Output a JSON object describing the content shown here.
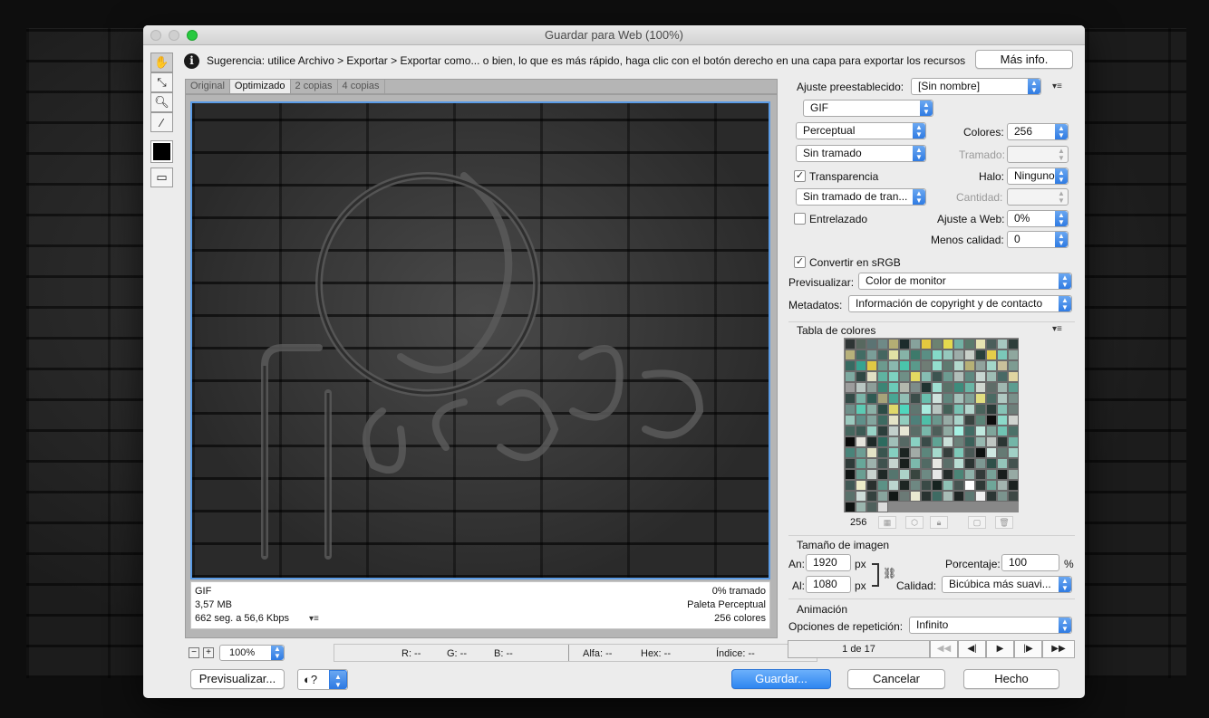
{
  "window": {
    "title": "Guardar para Web (100%)"
  },
  "hint": {
    "icon": "info-icon",
    "text": "Sugerencia: utilice Archivo > Exportar > Exportar como... o bien, lo que es más rápido, haga clic con el botón derecho en una capa para exportar los recursos",
    "more_button": "Más info."
  },
  "tools": [
    "hand-tool-icon",
    "slice-select-tool-icon",
    "zoom-tool-icon",
    "eyedropper-tool-icon",
    "eyedropper-color-icon",
    "toggle-slices-icon"
  ],
  "tabs": [
    "Original",
    "Optimizado",
    "2 copias",
    "4 copias"
  ],
  "preview_info": {
    "format": "GIF",
    "size": "3,57 MB",
    "time": "662 seg. a 56,6 Kbps",
    "dither": "0% tramado",
    "palette": "Paleta Perceptual",
    "colors": "256 colores"
  },
  "statusbar": {
    "zoom": "100%",
    "r_label": "R: --",
    "g_label": "G: --",
    "b_label": "B: --",
    "alpha_label": "Alfa: --",
    "hex_label": "Hex: --",
    "index_label": "Índice: --"
  },
  "settings": {
    "preset_label": "Ajuste preestablecido:",
    "preset_value": "[Sin nombre]",
    "format": "GIF",
    "reduction": "Perceptual",
    "colors_label": "Colores:",
    "colors_value": "256",
    "dither_algo": "Sin tramado",
    "dither_label": "Tramado:",
    "transparency_label": "Transparencia",
    "transparency_checked": true,
    "matte_label": "Halo:",
    "matte_value": "Ninguno",
    "transparency_dither": "Sin tramado de tran...",
    "amount_label": "Cantidad:",
    "interlaced_label": "Entrelazado",
    "interlaced_checked": false,
    "web_snap_label": "Ajuste a Web:",
    "web_snap_value": "0%",
    "lossy_label": "Menos calidad:",
    "lossy_value": "0",
    "srgb_label": "Convertir en sRGB",
    "srgb_checked": true,
    "preview_label": "Previsualizar:",
    "preview_value": "Color de monitor",
    "metadata_label": "Metadatos:",
    "metadata_value": "Información de copyright y de contacto"
  },
  "color_table": {
    "title": "Tabla de colores",
    "count": "256",
    "colors": [
      "#2e3535",
      "#57685f",
      "#5b7373",
      "#6f8a87",
      "#b4ae74",
      "#1c2c2c",
      "#87a29c",
      "#e5c93f",
      "#6c8271",
      "#e4d94e",
      "#72b2a5",
      "#5a7a6c",
      "#e6e3b2",
      "#4a5e5b",
      "#a6c7c0",
      "#2d3d3a",
      "#b7b17b",
      "#426c64",
      "#7a9e98",
      "#456660",
      "#e2e1a5",
      "#86b3a7",
      "#3d7a6b",
      "#5a8f84",
      "#84d9c8",
      "#96c8bd",
      "#9dadaa",
      "#c8cfc9",
      "#29403b",
      "#e4cd4a",
      "#7bc8b9",
      "#8fa79e",
      "#376a61",
      "#36a391",
      "#e1c844",
      "#6c9a8e",
      "#8ab8af",
      "#4ac4ab",
      "#5a9a8b",
      "#6f7d75",
      "#93dfce",
      "#5e7a70",
      "#b3d9cd",
      "#b6b076",
      "#91a39d",
      "#a3d6c9",
      "#c9c09b",
      "#7d9c92",
      "#7eaaa1",
      "#2f4743",
      "#e1e0c4",
      "#5fb3a1",
      "#7dd1c0",
      "#6f8f86",
      "#e2da61",
      "#86bdb2",
      "#3c5450",
      "#6d9b91",
      "#b1bfba",
      "#5e8980",
      "#c7d6d1",
      "#9ebdb4",
      "#486965",
      "#e0d5a1",
      "#9c9c9c",
      "#b9c6c2",
      "#8e9e99",
      "#3c8575",
      "#6bcbb8",
      "#b3b8ad",
      "#7d8c89",
      "#1f3331",
      "#9fe0d2",
      "#597268",
      "#3d8c7c",
      "#6ab5a5",
      "#cfd6cf",
      "#5f6c68",
      "#a0b7b0",
      "#5c9d90",
      "#334a46",
      "#7ab4a8",
      "#2f5a53",
      "#a7a37a",
      "#49a694",
      "#92bfb4",
      "#3b4d49",
      "#69bfae",
      "#cfe2dc",
      "#60867d",
      "#a5c1ba",
      "#7fa097",
      "#e2de80",
      "#4b6a63",
      "#b0c9c2",
      "#79908a",
      "#6e8f89",
      "#5ccab3",
      "#8bb1a7",
      "#2c4b45",
      "#e0d86a",
      "#4fd6bd",
      "#5f7670",
      "#a8ebde",
      "#b8c5c0",
      "#436057",
      "#78c2b3",
      "#b3d5cd",
      "#49625b",
      "#2a3a37",
      "#86c3b6",
      "#6d7f7a",
      "#9bc9be",
      "#5f908a",
      "#83a59e",
      "#3d6a61",
      "#e4e3c7",
      "#91ccbf",
      "#4e807a",
      "#4ebfa8",
      "#6a978d",
      "#97aba5",
      "#a9d4ca",
      "#38423f",
      "#5b8477",
      "#0d0d0d",
      "#8cd9c9",
      "#d0d3cf",
      "#45665e",
      "#3c5a54",
      "#97d2c5",
      "#2c3e3b",
      "#c2cfcb",
      "#e7e6d5",
      "#5a6c67",
      "#79b7aa",
      "#4d5e59",
      "#90aaa2",
      "#a5f1e3",
      "#406b64",
      "#bfe8de",
      "#7fa59b",
      "#70c4b3",
      "#4c7068",
      "#0a0a0a",
      "#e5e4dc",
      "#1e2927",
      "#2d6b5f",
      "#a1bfb8",
      "#566864",
      "#89d0c2",
      "#3a4b48",
      "#5fa394",
      "#cbe0da",
      "#6b817a",
      "#3b615a",
      "#97b8b0",
      "#bfc6c2",
      "#2b3533",
      "#73b5a7",
      "#49847a",
      "#6d9d94",
      "#e3e3c6",
      "#3a554f",
      "#85cfc0",
      "#1c2422",
      "#a2aba7",
      "#5c867c",
      "#a5d9cc",
      "#363f3d",
      "#7ec9b9",
      "#4a5855",
      "#0e1211",
      "#cfe8e2",
      "#657a74",
      "#a1d0c6",
      "#2e3a38",
      "#67a799",
      "#9db2ac",
      "#3f524e",
      "#c5d4cf",
      "#181f1d",
      "#7cb9ac",
      "#516a64",
      "#e8e8e3",
      "#5a6e69",
      "#b8ddd3",
      "#2a3331",
      "#7e9892",
      "#2f5049",
      "#94c5ba",
      "#43524f",
      "#101413",
      "#6a9e92",
      "#c8d2ce",
      "#202826",
      "#55756e",
      "#acd2c8",
      "#38453f",
      "#6d8a83",
      "#e6e6e6",
      "#242c2a",
      "#4b8577",
      "#8fb2aa",
      "#323a38",
      "#77a197",
      "#191e1d",
      "#97aaa4",
      "#405854",
      "#edecc8",
      "#2a302e",
      "#5c9286",
      "#bcd5cf",
      "#1e2523",
      "#6e8882",
      "#3a4a46",
      "#162320",
      "#8ec0b4",
      "#475451",
      "#ffffff",
      "#2f3836",
      "#6fa699",
      "#a3b4af",
      "#1b2220",
      "#59716b",
      "#cddcd8",
      "#34413e",
      "#88a49d",
      "#121716",
      "#6b7a76",
      "#e9e8d0",
      "#293331",
      "#3e6b63",
      "#a8bdb7",
      "#1f2624",
      "#5c7872",
      "#f0f0f0",
      "#2c3634",
      "#7b948e",
      "#3d4845",
      "#0f1312",
      "#9bb5ae",
      "#4f605c",
      "#dcdcdc"
    ]
  },
  "image_size": {
    "title": "Tamaño de imagen",
    "width_label": "An:",
    "width_value": "1920",
    "height_label": "Al:",
    "height_value": "1080",
    "unit": "px",
    "percent_label": "Porcentaje:",
    "percent_value": "100",
    "percent_unit": "%",
    "quality_label": "Calidad:",
    "quality_value": "Bicúbica más suavi..."
  },
  "animation": {
    "title": "Animación",
    "loop_label": "Opciones de repetición:",
    "loop_value": "Infinito",
    "frame_counter": "1 de 17"
  },
  "footer": {
    "preview_button": "Previsualizar...",
    "save_button": "Guardar...",
    "cancel_button": "Cancelar",
    "done_button": "Hecho"
  },
  "colors": {
    "accent": "#3d8ef0",
    "canvas_border": "#5a9be6"
  }
}
